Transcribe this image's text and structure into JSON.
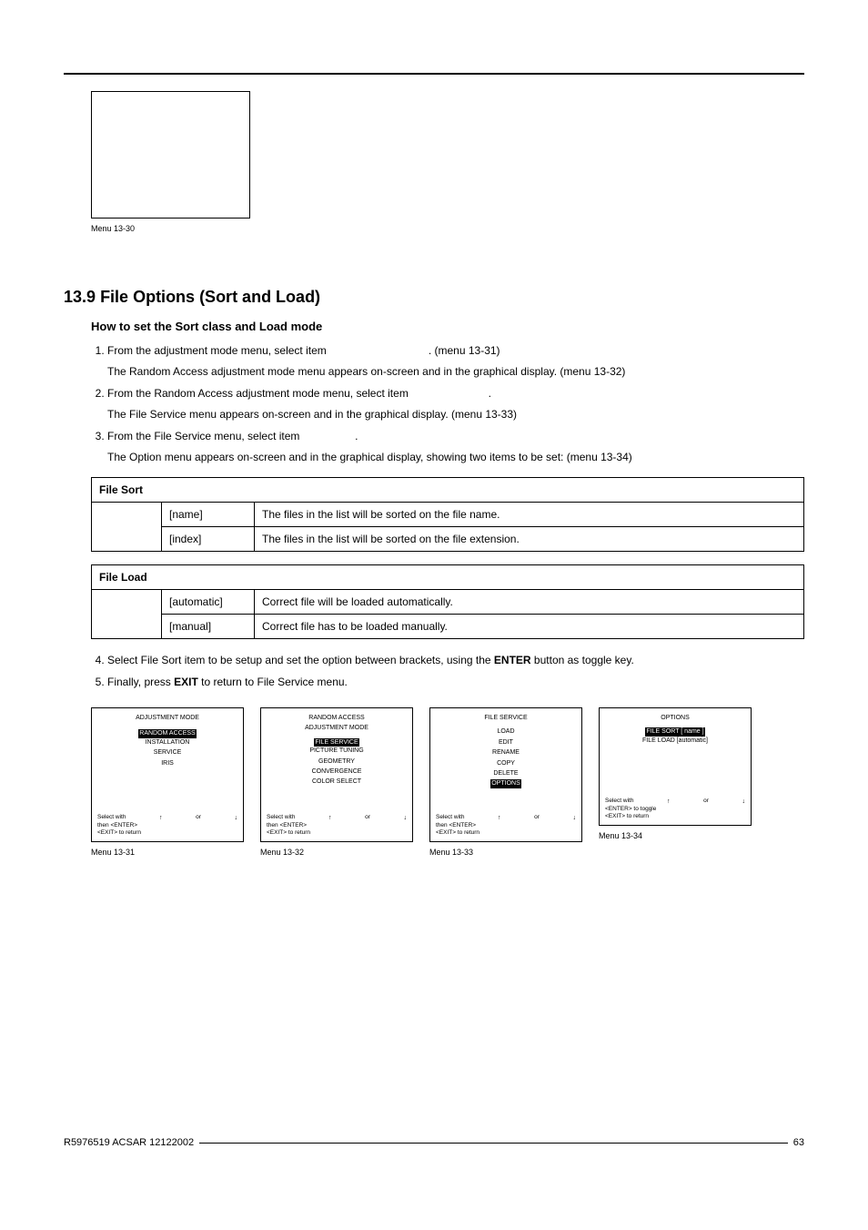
{
  "top_menu": {
    "caption": "Menu 13-30"
  },
  "section": {
    "number": "13.9",
    "title": "File Options (Sort and Load)",
    "subtitle": "How to set the Sort class and Load mode"
  },
  "steps": {
    "s1a": "From the adjustment mode menu, select item",
    "s1a_ref": ". (menu 13-31)",
    "s1b": "The Random Access adjustment mode menu appears on-screen and in the graphical display. (menu 13-32)",
    "s2a": "From the Random Access adjustment mode menu, select item",
    "s2a_end": ".",
    "s2b": "The File Service menu appears on-screen and in the graphical display. (menu 13-33)",
    "s3a": "From the File Service menu, select item",
    "s3a_end": ".",
    "s3b": "The Option menu appears on-screen and in the graphical display, showing two items to be set: (menu 13-34)",
    "s4a": "Select File Sort item to be setup and set the option between brackets, using the ",
    "s4b": "ENTER",
    "s4c": " button as toggle key.",
    "s5a": "Finally, press ",
    "s5b": "EXIT",
    "s5c": " to return to File Service menu."
  },
  "table_sort": {
    "header": "File Sort",
    "rows": [
      {
        "label": "[name]",
        "desc": "The files in the list will be sorted on the file name."
      },
      {
        "label": "[index]",
        "desc": "The files in the list will be sorted on the file extension."
      }
    ]
  },
  "table_load": {
    "header": "File Load",
    "rows": [
      {
        "label": "[automatic]",
        "desc": "Correct file will be loaded automatically."
      },
      {
        "label": "[manual]",
        "desc": "Correct file has to be loaded manually."
      }
    ]
  },
  "menus": {
    "m31": {
      "caption": "Menu 13-31",
      "title": "ADJUSTMENT MODE",
      "hl": "RANDOM ACCESS",
      "items": [
        "INSTALLATION",
        "SERVICE",
        "IRIS"
      ],
      "foot_l1a": "Select with",
      "foot_l1b": "then <ENTER>",
      "foot_l2a": "<EXIT> to return"
    },
    "m32": {
      "caption": "Menu 13-32",
      "title": "RANDOM ACCESS",
      "title2": "ADJUSTMENT MODE",
      "hl": "FILE SERVICE",
      "items": [
        "PICTURE TUNING",
        "GEOMETRY",
        "CONVERGENCE",
        "COLOR SELECT"
      ],
      "foot_l1a": "Select with",
      "foot_l1b": "then <ENTER>",
      "foot_l2a": "<EXIT> to return"
    },
    "m33": {
      "caption": "Menu 13-33",
      "title": "FILE SERVICE",
      "items_pre": [
        "LOAD",
        "EDIT",
        "RENAME",
        "COPY",
        "DELETE"
      ],
      "hl": "OPTIONS",
      "foot_l1a": "Select with",
      "foot_l1b": "then <ENTER>",
      "foot_l2a": "<EXIT> to return"
    },
    "m34": {
      "caption": "Menu 13-34",
      "title": "OPTIONS",
      "hl": "FILE SORT [ name ]",
      "items": [
        "FILE LOAD [automatic]"
      ],
      "foot_l1a": "Select with",
      "foot_l1b": "or",
      "foot_l2a": "<ENTER> to toggle",
      "foot_l2b": "<EXIT> to return"
    }
  },
  "footer": {
    "left": "R5976519  ACSAR  12122002",
    "right": "63"
  }
}
